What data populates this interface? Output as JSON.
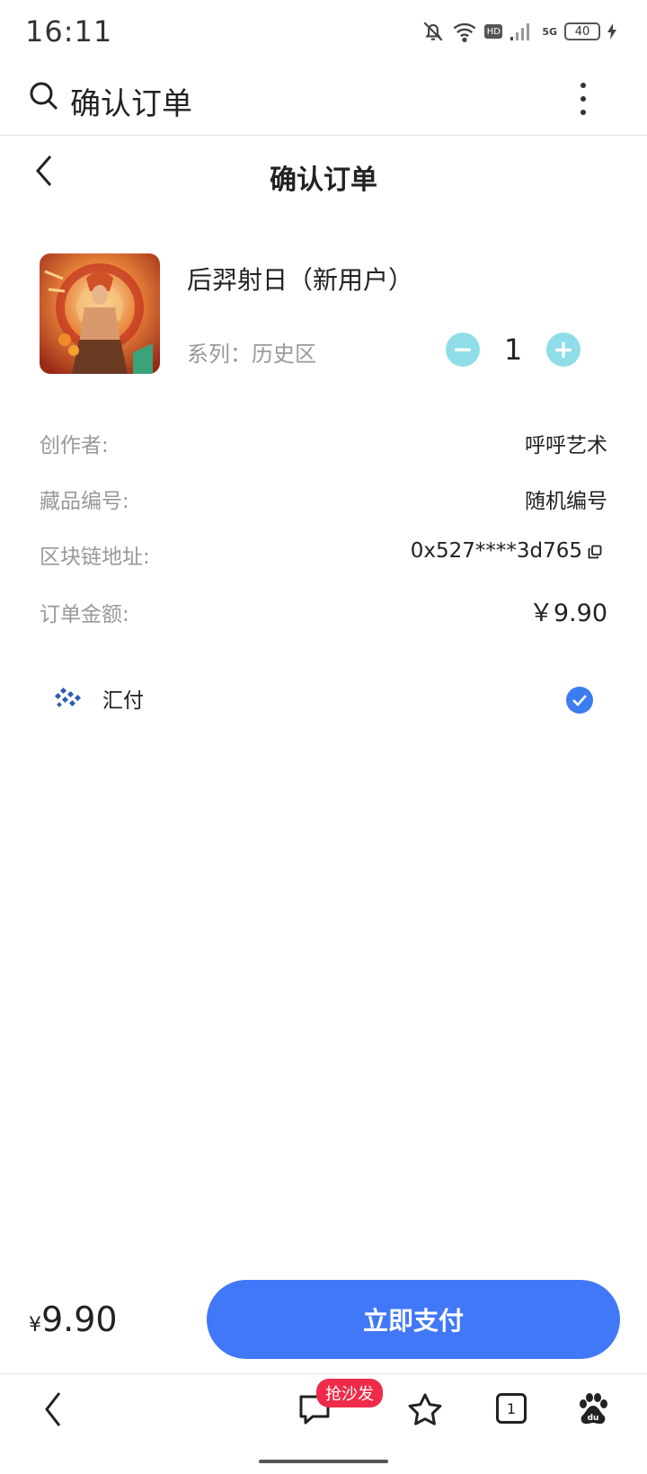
{
  "status_bar": {
    "time": "16:11",
    "hd": "HD",
    "network": "5G",
    "battery": "40"
  },
  "browser": {
    "search_text": "确认订单"
  },
  "page": {
    "title": "确认订单"
  },
  "product": {
    "name": "后羿射日（新用户）",
    "series": "系列：历史区",
    "quantity": "1",
    "minus_symbol": "−",
    "plus_symbol": "+"
  },
  "info": {
    "creator_label": "创作者:",
    "creator_value": "呼呼艺术",
    "item_no_label": "藏品编号:",
    "item_no_value": "随机编号",
    "chain_label": "区块链地址:",
    "chain_value": "0x527****3d765",
    "amount_label": "订单金额:",
    "amount_value": "￥9.90"
  },
  "payment": {
    "method": "汇付",
    "selected": true
  },
  "bottom_bar": {
    "currency": "¥",
    "price": "9.90",
    "pay_button": "立即支付"
  },
  "nav": {
    "sofa_badge": "抢沙发",
    "tab_count": "1"
  },
  "colors": {
    "accent": "#4178f7",
    "stepper": "#8fdde9",
    "badge": "#ee2b4a"
  }
}
